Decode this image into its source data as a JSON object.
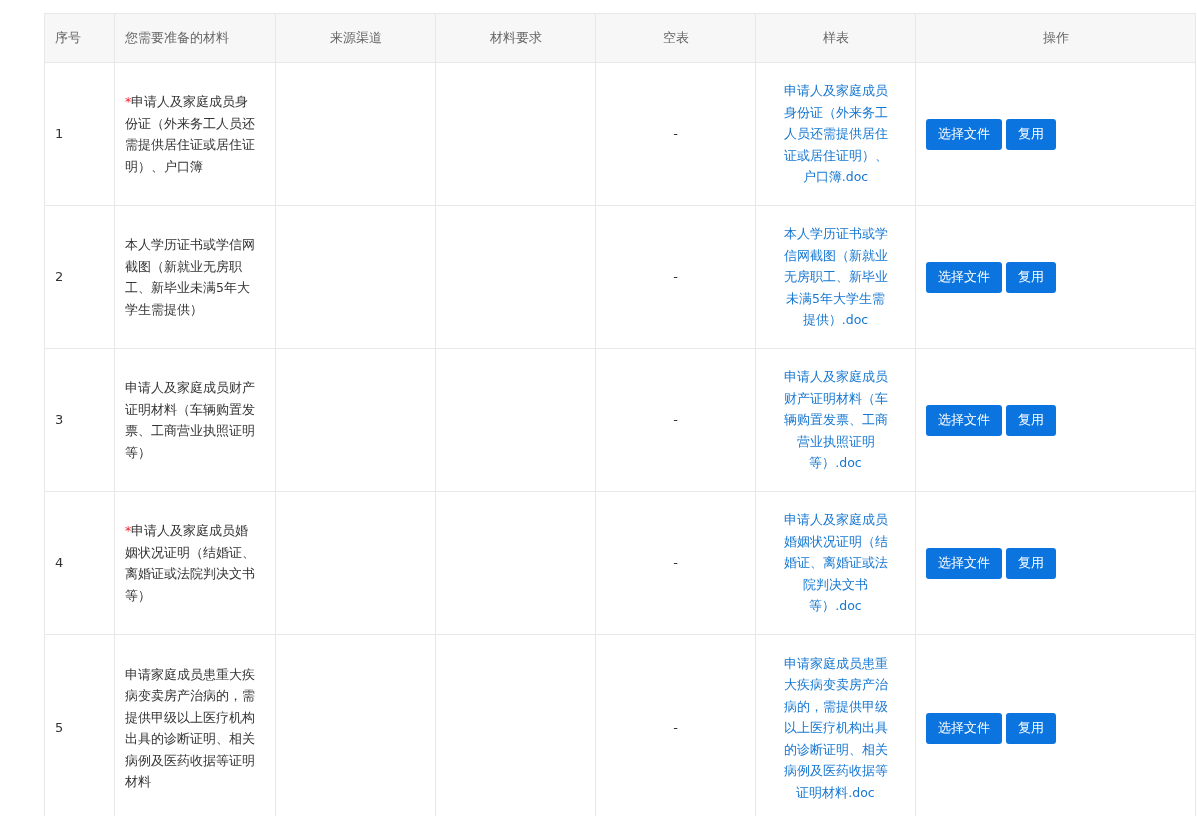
{
  "table": {
    "columns": [
      "序号",
      "您需要准备的材料",
      "来源渠道",
      "材料要求",
      "空表",
      "样表",
      "操作"
    ],
    "rows": [
      {
        "index": "1",
        "required_mark": "*",
        "material": "申请人及家庭成员身份证（外来务工人员还需提供居住证或居住证明）、户口簿",
        "blank_form": "-",
        "sample": "申请人及家庭成员身份证（外来务工人员还需提供居住证或居住证明）、户口簿.doc",
        "actions": [
          "选择文件",
          "复用"
        ]
      },
      {
        "index": "2",
        "material": "本人学历证书或学信网截图（新就业无房职工、新毕业未满5年大学生需提供）",
        "blank_form": "-",
        "sample": "本人学历证书或学信网截图（新就业无房职工、新毕业未满5年大学生需提供）.doc",
        "actions": [
          "选择文件",
          "复用"
        ]
      },
      {
        "index": "3",
        "material": "申请人及家庭成员财产证明材料（车辆购置发票、工商营业执照证明等）",
        "blank_form": "-",
        "sample": "申请人及家庭成员财产证明材料（车辆购置发票、工商营业执照证明等）.doc",
        "actions": [
          "选择文件",
          "复用"
        ]
      },
      {
        "index": "4",
        "required_mark": "*",
        "material": "申请人及家庭成员婚姻状况证明（结婚证、离婚证或法院判决文书等）",
        "blank_form": "-",
        "sample": "申请人及家庭成员婚姻状况证明（结婚证、离婚证或法院判决文书等）.doc",
        "actions": [
          "选择文件",
          "复用"
        ]
      },
      {
        "index": "5",
        "material": "申请家庭成员患重大疾病变卖房产治病的，需提供甲级以上医疗机构出具的诊断证明、相关病例及医药收据等证明材料",
        "blank_form": "-",
        "sample": "申请家庭成员患重大疾病变卖房产治病的，需提供甲级以上医疗机构出具的诊断证明、相关病例及医药收据等证明材料.doc",
        "actions": [
          "选择文件",
          "复用"
        ]
      }
    ]
  }
}
